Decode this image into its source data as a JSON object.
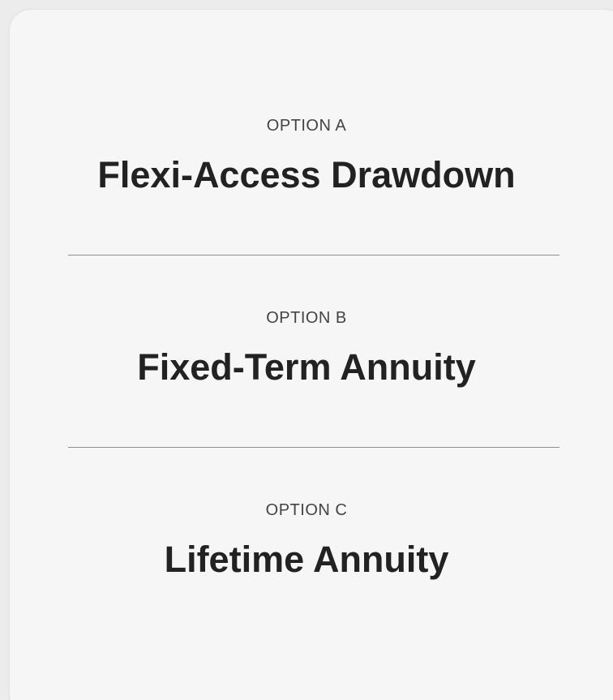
{
  "options": [
    {
      "eyebrow": "OPTION A",
      "title": "Flexi-Access Drawdown"
    },
    {
      "eyebrow": "OPTION B",
      "title": "Fixed-Term Annuity"
    },
    {
      "eyebrow": "OPTION C",
      "title": "Lifetime Annuity"
    }
  ]
}
